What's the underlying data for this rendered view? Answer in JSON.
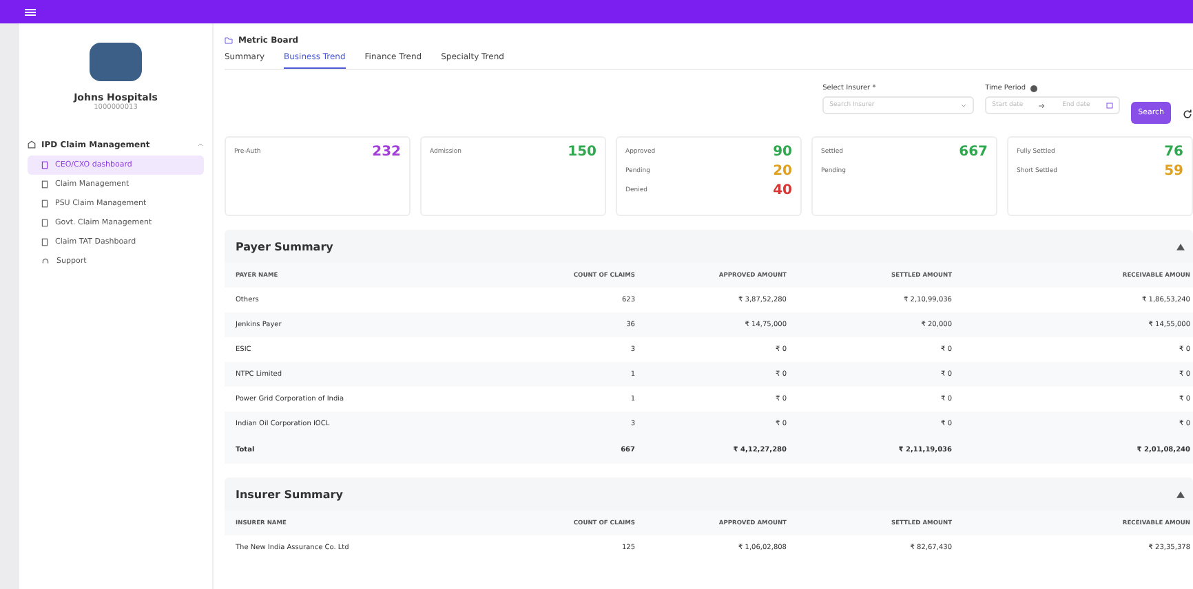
{
  "sidebar": {
    "hospital_name": "Johns Hospitals",
    "hospital_id": "1000000013",
    "section": {
      "label": "IPD Claim Management",
      "expanded": true,
      "items": [
        {
          "label": "CEO/CXO dashboard",
          "selected": true
        },
        {
          "label": "Claim Management",
          "selected": false
        },
        {
          "label": "PSU Claim Management",
          "selected": false
        },
        {
          "label": "Govt. Claim Management",
          "selected": false
        },
        {
          "label": "Claim TAT Dashboard",
          "selected": false
        }
      ]
    },
    "support": "Support"
  },
  "breadcrumb": "Metric Board",
  "tabs": [
    {
      "label": "Summary",
      "selected": false
    },
    {
      "label": "Business Trend",
      "selected": true
    },
    {
      "label": "Finance Trend",
      "selected": false
    },
    {
      "label": "Specialty Trend",
      "selected": false
    }
  ],
  "filters": {
    "insurer_label": "Select Insurer *",
    "insurer_placeholder": "Search Insurer",
    "period_label": "Time Period",
    "start_placeholder": "Start date",
    "end_placeholder": "End date",
    "search_button": "Search"
  },
  "metric_cards": [
    {
      "lines": [
        {
          "label": "Pre-Auth",
          "value": "232",
          "color": "#a23fd6"
        }
      ]
    },
    {
      "lines": [
        {
          "label": "Admission",
          "value": "150",
          "color": "#2fa84f"
        }
      ]
    },
    {
      "lines": [
        {
          "label": "Approved",
          "value": "90",
          "color": "#2fa84f"
        },
        {
          "label": "Pending",
          "value": "20",
          "color": "#e0a020"
        },
        {
          "label": "Denied",
          "value": "40",
          "color": "#d93636"
        }
      ]
    },
    {
      "lines": [
        {
          "label": "Settled",
          "value": "667",
          "color": "#2fa84f"
        },
        {
          "label": "Pending"
        }
      ]
    },
    {
      "lines": [
        {
          "label": "Fully Settled",
          "value": "76",
          "color": "#2fa84f"
        },
        {
          "label": "Short Settled",
          "value": "59",
          "color": "#e0a020"
        }
      ]
    }
  ],
  "tables": [
    {
      "title": "Payer Summary",
      "collapsed": false,
      "columns": [
        "PAYER NAME",
        "COUNT OF CLAIMS",
        "APPROVED AMOUNT",
        "SETTLED AMOUNT",
        "RECEIVABLE AMOUN"
      ],
      "rows": [
        [
          "Others",
          "623",
          "₹ 3,87,52,280",
          "₹ 2,10,99,036",
          "₹ 1,86,53,240"
        ],
        [
          "Jenkins Payer",
          "36",
          "₹ 14,75,000",
          "₹ 20,000",
          "₹ 14,55,000"
        ],
        [
          "ESIC",
          "3",
          "₹ 0",
          "₹ 0",
          "₹ 0"
        ],
        [
          "NTPC Limited",
          "1",
          "₹ 0",
          "₹ 0",
          "₹ 0"
        ],
        [
          "Power Grid Corporation of India",
          "1",
          "₹ 0",
          "₹ 0",
          "₹ 0"
        ],
        [
          "Indian Oil Corporation IOCL",
          "3",
          "₹ 0",
          "₹ 0",
          "₹ 0"
        ]
      ],
      "total": [
        "Total",
        "667",
        "₹ 4,12,27,280",
        "₹ 2,11,19,036",
        "₹ 2,01,08,240"
      ]
    },
    {
      "title": "Insurer Summary",
      "collapsed": false,
      "columns": [
        "INSURER NAME",
        "COUNT OF CLAIMS",
        "APPROVED AMOUNT",
        "SETTLED AMOUNT",
        "RECEIVABLE AMOUN"
      ],
      "rows": [
        [
          "The New India Assurance Co. Ltd",
          "125",
          "₹ 1,06,02,808",
          "₹ 82,67,430",
          "₹ 23,35,378"
        ]
      ]
    }
  ]
}
